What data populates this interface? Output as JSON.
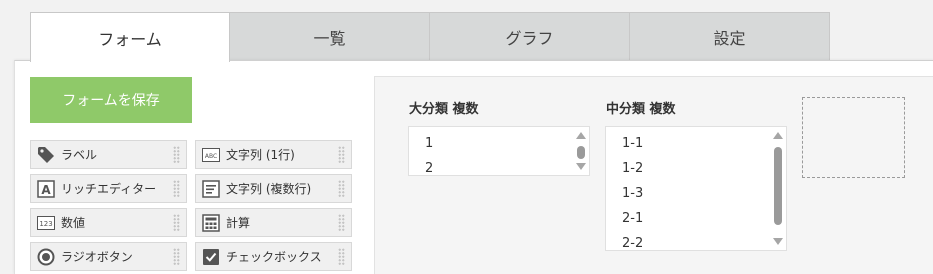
{
  "tabs": [
    {
      "label": "フォーム",
      "active": true
    },
    {
      "label": "一覧",
      "active": false
    },
    {
      "label": "グラフ",
      "active": false
    },
    {
      "label": "設定",
      "active": false
    }
  ],
  "save_button": {
    "label": "フォームを保存",
    "color": "#8fc969"
  },
  "palette": [
    {
      "label": "ラベル",
      "icon": "tag-icon"
    },
    {
      "label": "文字列 (1行)",
      "icon": "text-abc-icon"
    },
    {
      "label": "リッチエディター",
      "icon": "rich-editor-icon"
    },
    {
      "label": "文字列 (複数行)",
      "icon": "multiline-text-icon"
    },
    {
      "label": "数値",
      "icon": "number-icon"
    },
    {
      "label": "計算",
      "icon": "calculator-icon"
    },
    {
      "label": "ラジオボタン",
      "icon": "radio-icon"
    },
    {
      "label": "チェックボックス",
      "icon": "checkbox-icon"
    }
  ],
  "fields": [
    {
      "label": "大分類 複数",
      "options": [
        "1",
        "2"
      ]
    },
    {
      "label": "中分類 複数",
      "options": [
        "1-1",
        "1-2",
        "1-3",
        "2-1",
        "2-2"
      ]
    }
  ]
}
